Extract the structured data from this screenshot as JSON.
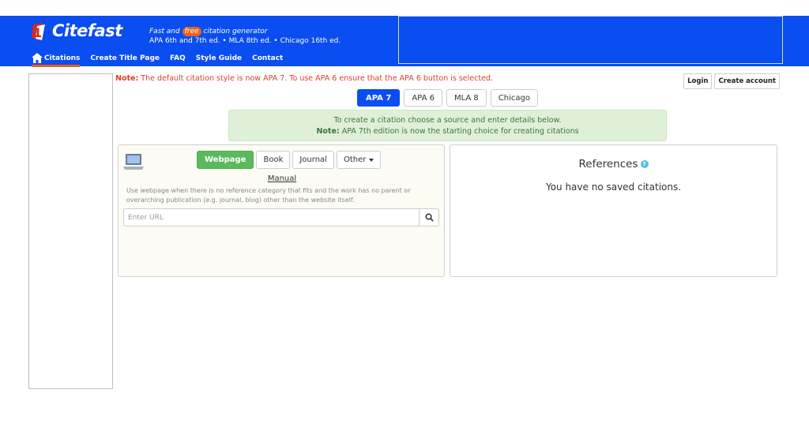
{
  "header": {
    "logo_text": "Citefast",
    "tagline_prefix": "Fast and ",
    "tagline_free": "free",
    "tagline_suffix": " citation generator",
    "tagline_line2": "APA 6th and 7th ed. • MLA 8th ed. • Chicago 16th ed.",
    "brand_color": "#0a4df0",
    "accent_color": "#e8621a"
  },
  "nav": {
    "items": [
      {
        "label": "Citations",
        "icon": "home-icon"
      },
      {
        "label": "Create Title Page"
      },
      {
        "label": "FAQ"
      },
      {
        "label": "Style Guide"
      },
      {
        "label": "Contact"
      }
    ]
  },
  "note": {
    "prefix": "Note:",
    "text": " The default citation style is now APA 7. To use APA 6 ensure that the APA 6 button is selected."
  },
  "auth": {
    "login": "Login",
    "create_account": "Create account"
  },
  "styles": {
    "selected": "APA 7",
    "buttons": [
      "APA 7",
      "APA 6",
      "MLA 8",
      "Chicago"
    ]
  },
  "info": {
    "line1": "To create a citation choose a source and enter details below.",
    "line2_prefix": "Note:",
    "line2_text": " APA 7th edition is now the starting choice for creating citations"
  },
  "source": {
    "icon": "laptop-icon",
    "tabs": [
      "Webpage",
      "Book",
      "Journal",
      "Other"
    ],
    "selected": "Webpage",
    "manual_label": "Manual",
    "description": "Use webpage when there is no reference category that fits and the work has no parent or overarching publication (e.g. journal, blog) other than the website itself.",
    "url_placeholder": "Enter URL",
    "url_value": ""
  },
  "references": {
    "title": "References",
    "help": "?",
    "empty_text": "You have no saved citations."
  }
}
